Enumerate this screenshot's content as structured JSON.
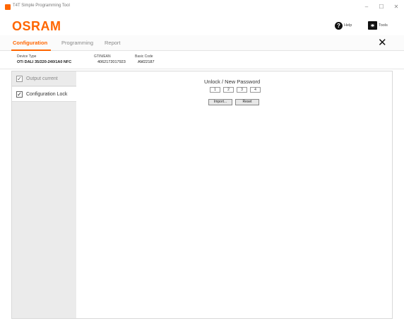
{
  "window": {
    "title": "T4T Simple Programming Tool",
    "controls": {
      "minimize": "–",
      "maximize": "☐",
      "close": "✕"
    }
  },
  "header": {
    "logo": "OSRAM",
    "help_label": "Help",
    "tools_label": "Tools",
    "help_icon": "?",
    "close_symbol": "✕"
  },
  "tabs": [
    {
      "label": "Configuration",
      "active": true
    },
    {
      "label": "Programming",
      "active": false
    },
    {
      "label": "Report",
      "active": false
    }
  ],
  "device": {
    "type_label": "Device Type",
    "type_value": "OTi DALI 35/220-240/1A0 NFC",
    "gtin_label": "GTIN/EAN",
    "gtin_value": "4062172017923",
    "basic_code_label": "Basic Code",
    "basic_code_value": "AM22187"
  },
  "sidebar": {
    "items": [
      {
        "label": "Output current",
        "checked": true,
        "active": false
      },
      {
        "label": "Configuration Lock",
        "checked": true,
        "active": true
      }
    ],
    "check_symbol": "✓"
  },
  "unlock": {
    "title": "Unlock / New Password",
    "digits": [
      "1",
      "2",
      "3",
      "4"
    ],
    "import_label": "Import...",
    "reset_label": "Reset"
  },
  "colors": {
    "accent": "#ff6600"
  }
}
